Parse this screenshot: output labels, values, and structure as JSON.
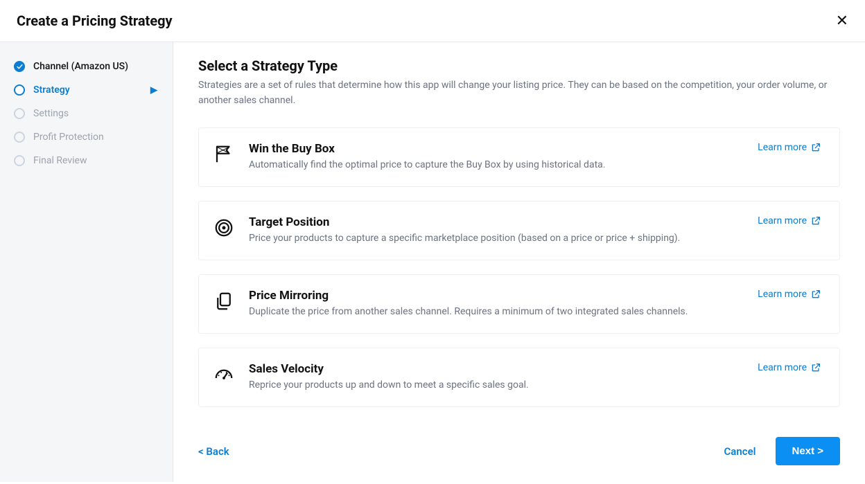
{
  "header": {
    "title": "Create a Pricing Strategy"
  },
  "sidebar": {
    "steps": [
      {
        "label": "Channel (Amazon US)",
        "state": "completed"
      },
      {
        "label": "Strategy",
        "state": "active"
      },
      {
        "label": "Settings",
        "state": "pending"
      },
      {
        "label": "Profit Protection",
        "state": "pending"
      },
      {
        "label": "Final Review",
        "state": "pending"
      }
    ]
  },
  "main": {
    "title": "Select a Strategy Type",
    "description": "Strategies are a set of rules that determine how this app will change your listing price. They can be based on the competition, your order volume, or another sales channel.",
    "learn_more_label": "Learn more",
    "strategies": [
      {
        "icon": "flag-icon",
        "title": "Win the Buy Box",
        "desc": "Automatically find the optimal price to capture the Buy Box by using historical data."
      },
      {
        "icon": "target-icon",
        "title": "Target Position",
        "desc": "Price your products to capture a specific marketplace position (based on a price or price + shipping)."
      },
      {
        "icon": "copy-icon",
        "title": "Price Mirroring",
        "desc": "Duplicate the price from another sales channel. Requires a minimum of two integrated sales channels."
      },
      {
        "icon": "gauge-icon",
        "title": "Sales Velocity",
        "desc": "Reprice your products up and down to meet a specific sales goal."
      }
    ]
  },
  "footer": {
    "back": "< Back",
    "cancel": "Cancel",
    "next": "Next >"
  }
}
